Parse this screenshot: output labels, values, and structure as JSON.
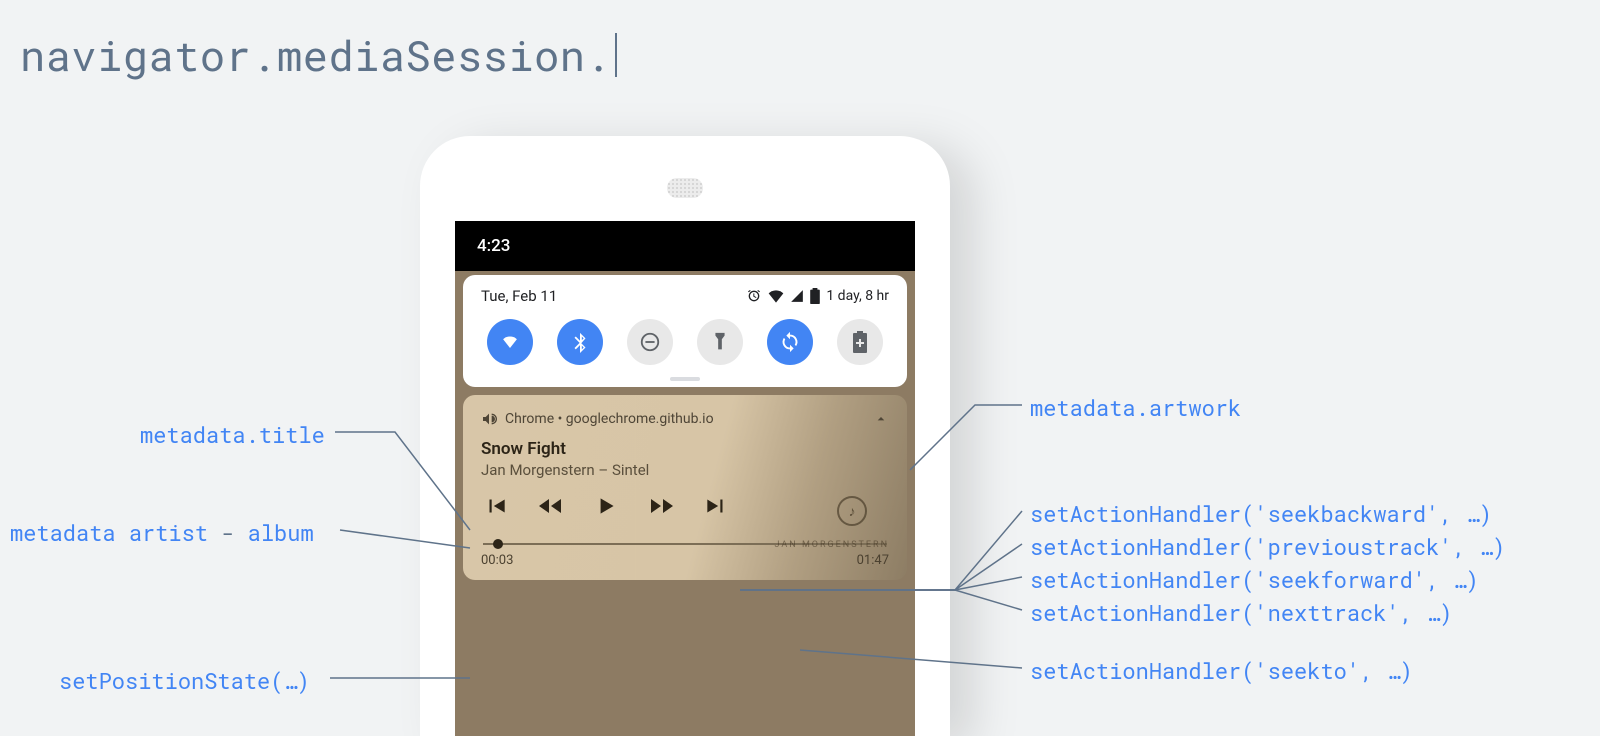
{
  "header": {
    "code": "navigator.mediaSession."
  },
  "phone": {
    "statusbar": {
      "time": "4:23"
    },
    "qs": {
      "date": "Tue, Feb 11",
      "battery_text": "1 day, 8 hr",
      "toggles": [
        {
          "name": "wifi-icon",
          "on": true
        },
        {
          "name": "bluetooth-icon",
          "on": true
        },
        {
          "name": "dnd-icon",
          "on": false
        },
        {
          "name": "flashlight-icon",
          "on": false
        },
        {
          "name": "sync-icon",
          "on": true
        },
        {
          "name": "battery-saver-icon",
          "on": false
        }
      ]
    },
    "media": {
      "app_label": "Chrome",
      "separator": " • ",
      "site": "googlechrome.github.io",
      "title": "Snow Fight",
      "artist": "Jan Morgenstern",
      "album": "Sintel",
      "artist_album_sep": " – ",
      "position": "00:03",
      "duration": "01:47",
      "artwork_caption": "JAN MORGENSTERN"
    }
  },
  "annotations": {
    "left": {
      "title": "metadata.title",
      "artist_album_pre": "metadata artist",
      "artist_album_dash": " - ",
      "artist_album_post": "album",
      "position": "setPositionState(…)"
    },
    "right": {
      "artwork": "metadata.artwork",
      "seekbackward": "setActionHandler('seekbackward', …)",
      "previoustrack": "setActionHandler('previoustrack', …)",
      "seekforward": "setActionHandler('seekforward', …)",
      "nexttrack": "setActionHandler('nexttrack', …)",
      "seekto": "setActionHandler('seekto', …)"
    }
  }
}
